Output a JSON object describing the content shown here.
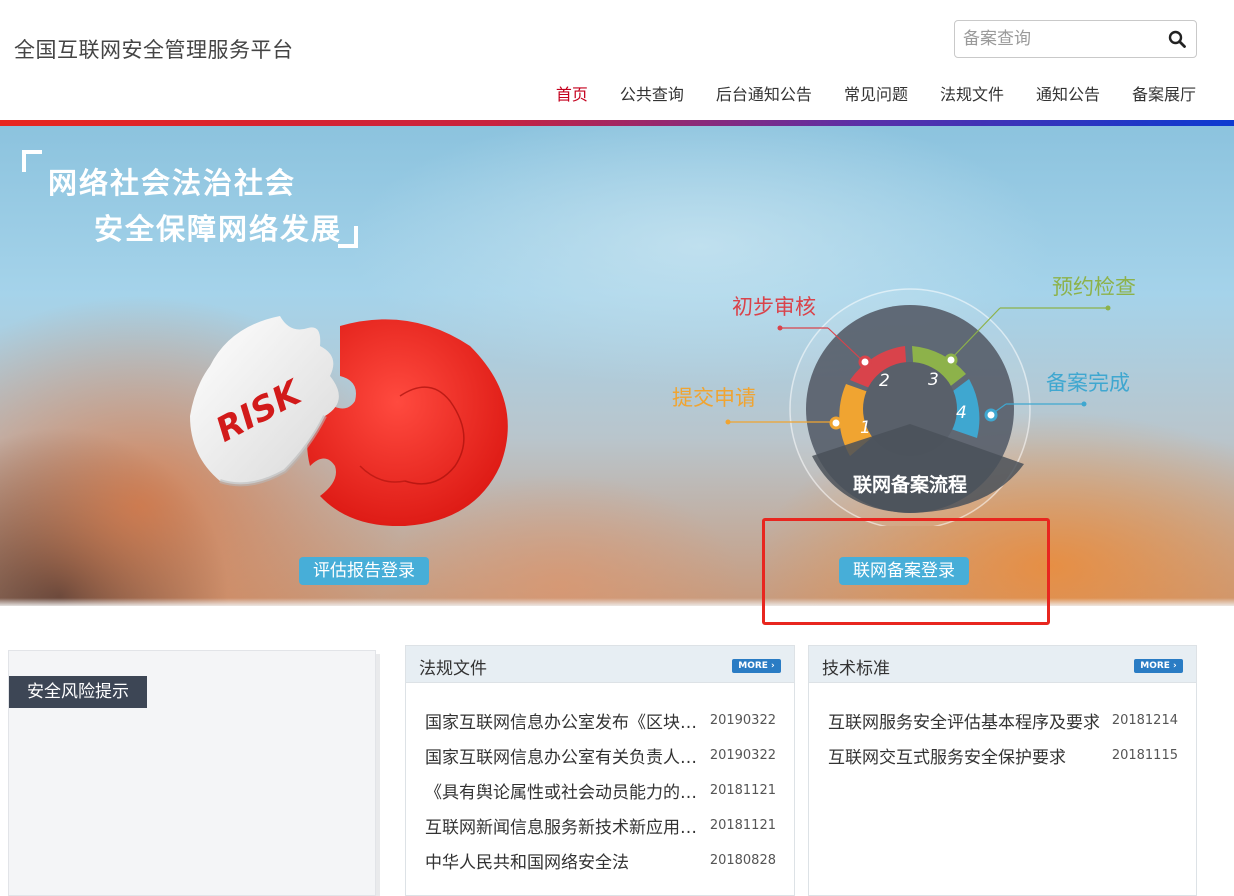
{
  "header": {
    "site_title": "全国互联网安全管理服务平台",
    "search": {
      "placeholder": "备案查询",
      "value": ""
    }
  },
  "nav": [
    {
      "label": "首页",
      "active": true
    },
    {
      "label": "公共查询"
    },
    {
      "label": "后台通知公告"
    },
    {
      "label": "常见问题"
    },
    {
      "label": "法规文件"
    },
    {
      "label": "通知公告"
    },
    {
      "label": "备案展厅"
    }
  ],
  "banner": {
    "slogan_line1": "网络社会法治社会",
    "slogan_line2": "安全保障网络发展",
    "puzzle_text": "RISK",
    "flow": {
      "center": "联网备案流程",
      "steps": [
        {
          "num": "1",
          "label": "提交申请",
          "color": "#f0a431"
        },
        {
          "num": "2",
          "label": "初步审核",
          "color": "#d9434b"
        },
        {
          "num": "3",
          "label": "预约检查",
          "color": "#8db24a"
        },
        {
          "num": "4",
          "label": "备案完成",
          "color": "#3fa7d0"
        }
      ]
    },
    "report_login": "评估报告登录",
    "filing_login": "联网备案登录"
  },
  "risk_panel": {
    "title": "安全风险提示"
  },
  "law_panel": {
    "title": "法规文件",
    "more": "MORE",
    "items": [
      {
        "title": "国家互联网信息办公室发布《区块链信息服务管理规定》",
        "date": "20190322"
      },
      {
        "title": "国家互联网信息办公室有关负责人就《区块链信息服务管理规定》答记者问",
        "date": "20190322"
      },
      {
        "title": "《具有舆论属性或社会动员能力的互联网信息服务安全评估规定》",
        "date": "20181121"
      },
      {
        "title": "互联网新闻信息服务新技术新应用安全评估管理规定",
        "date": "20181121"
      },
      {
        "title": "中华人民共和国网络安全法",
        "date": "20180828"
      }
    ]
  },
  "tech_panel": {
    "title": "技术标准",
    "more": "MORE",
    "items": [
      {
        "title": "互联网服务安全评估基本程序及要求",
        "date": "20181214"
      },
      {
        "title": "互联网交互式服务安全保护要求",
        "date": "20181115"
      }
    ]
  }
}
